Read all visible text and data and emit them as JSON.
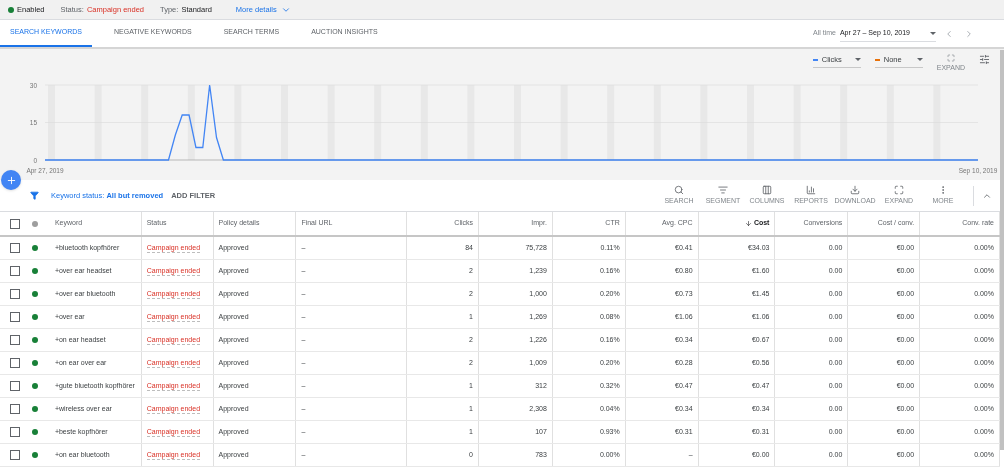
{
  "summary": {
    "state": "Enabled",
    "status_label": "Status:",
    "status_value": "Campaign ended",
    "type_label": "Type:",
    "type_value": "Standard",
    "more": "More details"
  },
  "tabs": [
    {
      "label": "SEARCH KEYWORDS",
      "selected": true
    },
    {
      "label": "NEGATIVE KEYWORDS",
      "selected": false
    },
    {
      "label": "SEARCH TERMS",
      "selected": false
    },
    {
      "label": "AUCTION INSIGHTS",
      "selected": false
    }
  ],
  "date_range": {
    "preset": "All time",
    "value": "Apr 27 – Sep 10, 2019"
  },
  "chart_controls": {
    "second_metric": {
      "label": "None",
      "color": "#e8710a"
    },
    "expand": "EXPAND"
  },
  "chart_data": {
    "type": "line",
    "categories": [
      "Apr 27, 2019",
      null,
      null,
      null,
      null,
      null,
      null,
      null,
      null,
      null,
      null,
      null,
      null,
      null,
      null,
      null,
      null,
      null,
      null,
      null,
      null,
      null,
      null,
      null,
      null,
      null,
      null,
      null,
      null,
      null,
      null,
      null,
      null,
      null,
      null,
      null,
      null,
      null,
      null,
      null,
      null,
      null,
      null,
      null,
      null,
      null,
      null,
      null,
      null,
      null,
      null,
      null,
      null,
      null,
      null,
      null,
      null,
      null,
      null,
      null,
      null,
      null,
      null,
      null,
      null,
      null,
      null,
      null,
      null,
      null,
      null,
      null,
      null,
      null,
      null,
      null,
      null,
      null,
      null,
      null,
      null,
      null,
      null,
      null,
      null,
      null,
      null,
      null,
      null,
      null,
      null,
      null,
      null,
      null,
      null,
      null,
      null,
      null,
      null,
      null,
      null,
      null,
      null,
      null,
      null,
      null,
      null,
      null,
      null,
      null,
      null,
      null,
      null,
      null,
      null,
      null,
      null,
      null,
      null,
      null,
      null,
      null,
      null,
      null,
      null,
      null,
      null,
      null,
      null,
      null,
      null,
      null,
      null,
      null,
      null,
      null,
      "Sep 10, 2019"
    ],
    "series": [
      {
        "name": "Clicks",
        "color": "#4285f4",
        "values": [
          0,
          0,
          0,
          0,
          0,
          0,
          0,
          0,
          0,
          0,
          0,
          0,
          0,
          0,
          0,
          0,
          0,
          0,
          0,
          10,
          18,
          18,
          5,
          5,
          30,
          9,
          0,
          0,
          0,
          0,
          0,
          0,
          0,
          0,
          0,
          0,
          0,
          0,
          0,
          0,
          0,
          0,
          0,
          0,
          0,
          0,
          0,
          0,
          0,
          0,
          0,
          0,
          0,
          0,
          0,
          0,
          0,
          0,
          0,
          0,
          0,
          0,
          0,
          0,
          0,
          0,
          0,
          0,
          0,
          0,
          0,
          0,
          0,
          0,
          0,
          0,
          0,
          0,
          0,
          0,
          0,
          0,
          0,
          0,
          0,
          0,
          0,
          0,
          0,
          0,
          0,
          0,
          0,
          0,
          0,
          0,
          0,
          0,
          0,
          0,
          0,
          0,
          0,
          0,
          0,
          0,
          0,
          0,
          0,
          0,
          0,
          0,
          0,
          0,
          0,
          0,
          0,
          0,
          0,
          0,
          0,
          0,
          0,
          0,
          0,
          0,
          0,
          0,
          0,
          0,
          0,
          0,
          0,
          0,
          0,
          0,
          0
        ]
      }
    ],
    "yticks": [
      0,
      15,
      30
    ],
    "ylim": [
      0,
      30
    ]
  },
  "filter": {
    "text": "Keyword status: **All but removed**",
    "add": "ADD FILTER"
  },
  "toolbar": [
    "SEARCH",
    "SEGMENT",
    "COLUMNS",
    "REPORTS",
    "DOWNLOAD",
    "EXPAND",
    "MORE"
  ],
  "table": {
    "all_checked": false,
    "columns": [
      {
        "label": "Keyword",
        "sorted": false
      },
      {
        "label": "Status",
        "sorted": false
      },
      {
        "label": "Policy details",
        "sorted": false
      },
      {
        "label": "Final URL",
        "sorted": false
      },
      {
        "label": "Clicks",
        "sorted": false
      },
      {
        "label": "Impr.",
        "sorted": false
      },
      {
        "label": "CTR",
        "sorted": false
      },
      {
        "label": "Avg. CPC",
        "sorted": false
      },
      {
        "label": "Cost",
        "sorted": true
      },
      {
        "label": "Conversions",
        "sorted": false
      },
      {
        "label": "Cost / conv.",
        "sorted": false
      },
      {
        "label": "Conv. rate",
        "sorted": false
      }
    ],
    "rows": [
      {
        "checked": false,
        "cells": [
          "+bluetooth kopfhörer",
          "Campaign ended",
          "Approved",
          "–",
          "84",
          "75,728",
          "0.11%",
          "€0.41",
          "€34.03",
          "0.00",
          "€0.00",
          "0.00%"
        ]
      },
      {
        "checked": false,
        "cells": [
          "+over ear headset",
          "Campaign ended",
          "Approved",
          "–",
          "2",
          "1,239",
          "0.16%",
          "€0.80",
          "€1.60",
          "0.00",
          "€0.00",
          "0.00%"
        ]
      },
      {
        "checked": false,
        "cells": [
          "+over ear bluetooth",
          "Campaign ended",
          "Approved",
          "–",
          "2",
          "1,000",
          "0.20%",
          "€0.73",
          "€1.45",
          "0.00",
          "€0.00",
          "0.00%"
        ]
      },
      {
        "checked": false,
        "cells": [
          "+over ear",
          "Campaign ended",
          "Approved",
          "–",
          "1",
          "1,269",
          "0.08%",
          "€1.06",
          "€1.06",
          "0.00",
          "€0.00",
          "0.00%"
        ]
      },
      {
        "checked": false,
        "cells": [
          "+on ear headset",
          "Campaign ended",
          "Approved",
          "–",
          "2",
          "1,226",
          "0.16%",
          "€0.34",
          "€0.67",
          "0.00",
          "€0.00",
          "0.00%"
        ]
      },
      {
        "checked": false,
        "cells": [
          "+on ear over ear",
          "Campaign ended",
          "Approved",
          "–",
          "2",
          "1,009",
          "0.20%",
          "€0.28",
          "€0.56",
          "0.00",
          "€0.00",
          "0.00%"
        ]
      },
      {
        "checked": false,
        "cells": [
          "+gute bluetooth kopfhörer",
          "Campaign ended",
          "Approved",
          "–",
          "1",
          "312",
          "0.32%",
          "€0.47",
          "€0.47",
          "0.00",
          "€0.00",
          "0.00%"
        ]
      },
      {
        "checked": false,
        "cells": [
          "+wireless over ear",
          "Campaign ended",
          "Approved",
          "–",
          "1",
          "2,308",
          "0.04%",
          "€0.34",
          "€0.34",
          "0.00",
          "€0.00",
          "0.00%"
        ]
      },
      {
        "checked": false,
        "cells": [
          "+beste kopfhörer",
          "Campaign ended",
          "Approved",
          "–",
          "1",
          "107",
          "0.93%",
          "€0.31",
          "€0.31",
          "0.00",
          "€0.00",
          "0.00%"
        ]
      },
      {
        "checked": false,
        "cells": [
          "+on ear bluetooth",
          "Campaign ended",
          "Approved",
          "–",
          "0",
          "783",
          "0.00%",
          "–",
          "€0.00",
          "0.00",
          "€0.00",
          "0.00%"
        ]
      }
    ]
  }
}
